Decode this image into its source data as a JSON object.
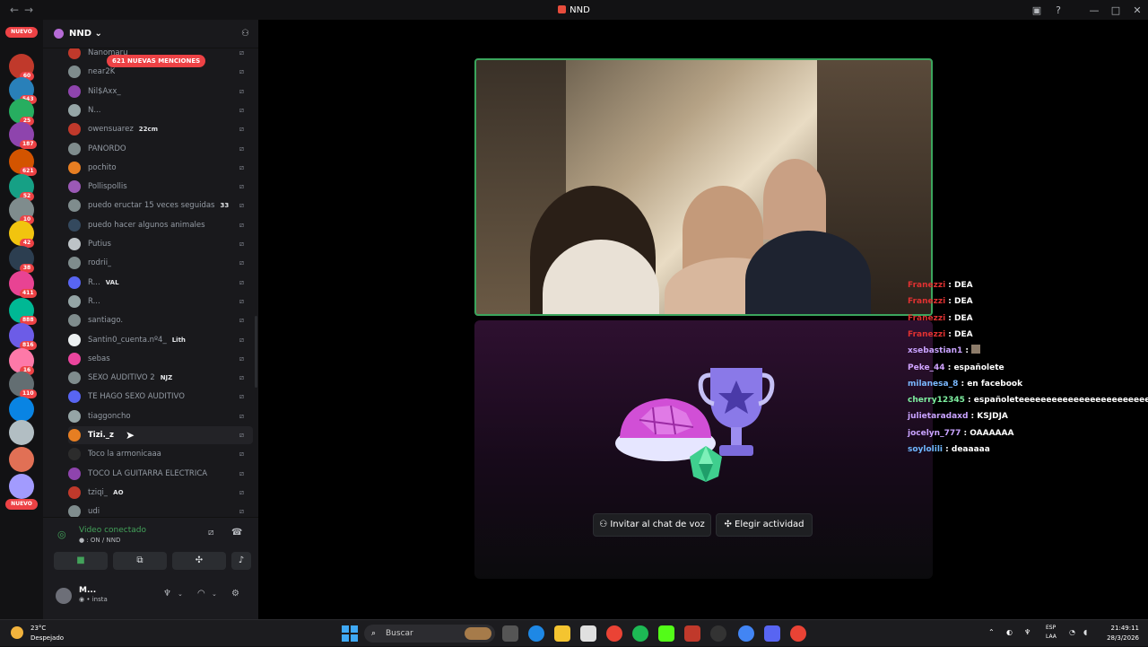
{
  "window": {
    "title": "NND",
    "nav_back": "←",
    "nav_fwd": "→"
  },
  "guilds": {
    "top_badge": "NUEVO",
    "bottom_badge": "NUEVO",
    "unread_counts": [
      "60",
      "543",
      "25",
      "187",
      "621",
      "52",
      "10",
      "42",
      "38",
      "411",
      "888",
      "816",
      "16",
      "110"
    ]
  },
  "server": {
    "name": "NND ⌄",
    "mentions_label": "621 NUEVAS MENCIONES"
  },
  "members": [
    {
      "name": "Nanomaru",
      "tag": "",
      "color": "#c0392b"
    },
    {
      "name": "near2K",
      "tag": "",
      "color": "#7f8c8d"
    },
    {
      "name": "Nil$Axx_",
      "tag": "",
      "color": "#8e44ad"
    },
    {
      "name": "N...",
      "tag": "",
      "color": "#95a5a6"
    },
    {
      "name": "owensuarez",
      "tag": "22cm",
      "color": "#c0392b"
    },
    {
      "name": "PAÑORDO",
      "tag": "",
      "color": "#7f8c8d"
    },
    {
      "name": "pochito",
      "tag": "",
      "color": "#e67e22"
    },
    {
      "name": "Pollispollis",
      "tag": "",
      "color": "#9b59b6"
    },
    {
      "name": "puedo eructar 15 veces seguidas",
      "tag": "33",
      "color": "#7f8c8d"
    },
    {
      "name": "puedo hacer algunos animales",
      "tag": "",
      "color": "#34495e"
    },
    {
      "name": "Putius",
      "tag": "",
      "color": "#bdc3c7"
    },
    {
      "name": "rodrii_",
      "tag": "",
      "color": "#7f8c8d"
    },
    {
      "name": "R...",
      "tag": "VAL",
      "color": "#5865f2"
    },
    {
      "name": "R...",
      "tag": "",
      "color": "#95a5a6"
    },
    {
      "name": "santiago.",
      "tag": "",
      "color": "#7f8c8d"
    },
    {
      "name": "Santin0_cuenta.nº4_",
      "tag": "Lith",
      "color": "#ecf0f1"
    },
    {
      "name": "sebas",
      "tag": "",
      "color": "#eb459e"
    },
    {
      "name": "SEXO AUDITIVO 2",
      "tag": "NJZ",
      "color": "#7f8c8d"
    },
    {
      "name": "TE HAGO SEXO AUDITIVO",
      "tag": "",
      "color": "#5865f2"
    },
    {
      "name": "tiaggoncho",
      "tag": "",
      "color": "#95a5a6"
    },
    {
      "name": "Tizi._z",
      "tag": "",
      "color": "#e67e22"
    },
    {
      "name": "Toco la armonicaaa",
      "tag": "",
      "color": "#2c2c2c"
    },
    {
      "name": "TOCO LA GUITARRA ELECTRICA",
      "tag": "",
      "color": "#8e44ad"
    },
    {
      "name": "tziqi_",
      "tag": "AO",
      "color": "#c0392b"
    },
    {
      "name": "udi",
      "tag": "",
      "color": "#7f8c8d"
    }
  ],
  "voice": {
    "status": "Video conectado",
    "channel": "ON / NND"
  },
  "user": {
    "name": "M...",
    "status": "insta"
  },
  "activity": {
    "invite_label": "Invitar al chat de voz",
    "activity_label": "Elegir actividad"
  },
  "chat": [
    {
      "user": "Franezzi",
      "msg": "DEA",
      "color": "#e03131"
    },
    {
      "user": "Franezzi",
      "msg": "DEA",
      "color": "#e03131"
    },
    {
      "user": "Franezzi",
      "msg": "DEA",
      "color": "#e03131"
    },
    {
      "user": "Franezzi",
      "msg": "DEA",
      "color": "#e03131"
    },
    {
      "user": "xsebastian1",
      "msg": "",
      "color": "#c9a3ff"
    },
    {
      "user": "Peke_44",
      "msg": "españolete",
      "color": "#d0a3ff"
    },
    {
      "user": "milanesa_8",
      "msg": "en facebook",
      "color": "#7ab8ff"
    },
    {
      "user": "cherry12345",
      "msg": "españoleteeeeeeeeeeeeeeeeeeeeeeeeeeeeeeeee",
      "color": "#7ef0a0"
    },
    {
      "user": "julietaradaxd",
      "msg": "KSJDJA",
      "color": "#c9a3ff"
    },
    {
      "user": "jocelyn_777",
      "msg": "OAAAAAA",
      "color": "#c9a3ff"
    },
    {
      "user": "soylolili",
      "msg": "deaaaaa",
      "color": "#6fb7ff"
    }
  ],
  "taskbar": {
    "temp": "23°C",
    "weather": "Despejado",
    "search": "Buscar",
    "lang1": "ESP",
    "lang2": "LAA",
    "time": "21:49:11",
    "date": "28/3/2026"
  }
}
